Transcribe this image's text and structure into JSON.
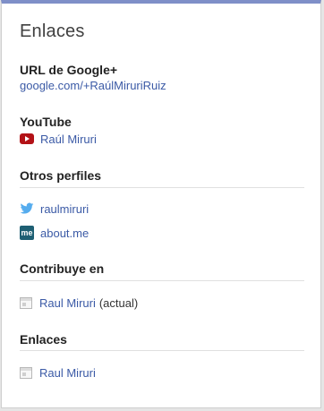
{
  "card": {
    "title": "Enlaces"
  },
  "google_plus": {
    "heading": "URL de Google+",
    "url": "google.com/+RaúlMiruriRuiz"
  },
  "youtube": {
    "heading": "YouTube",
    "link": "Raúl Miruri",
    "icon": "youtube-icon"
  },
  "otros_perfiles": {
    "heading": "Otros perfiles",
    "items": [
      {
        "label": "raulmiruri",
        "icon": "twitter-icon"
      },
      {
        "label": "about.me",
        "icon": "aboutme-icon",
        "icon_text": "me"
      }
    ]
  },
  "contribuye": {
    "heading": "Contribuye en",
    "items": [
      {
        "label": "Raul Miruri",
        "suffix": "(actual)",
        "icon": "page-icon"
      }
    ]
  },
  "enlaces": {
    "heading": "Enlaces",
    "items": [
      {
        "label": "Raul Miruri",
        "icon": "page-icon"
      }
    ]
  },
  "colors": {
    "accent_bar": "#7f8fc8",
    "link": "#3b5aa6",
    "youtube_red": "#b31217",
    "twitter_blue": "#55acee",
    "aboutme_teal": "#1e5f73"
  }
}
